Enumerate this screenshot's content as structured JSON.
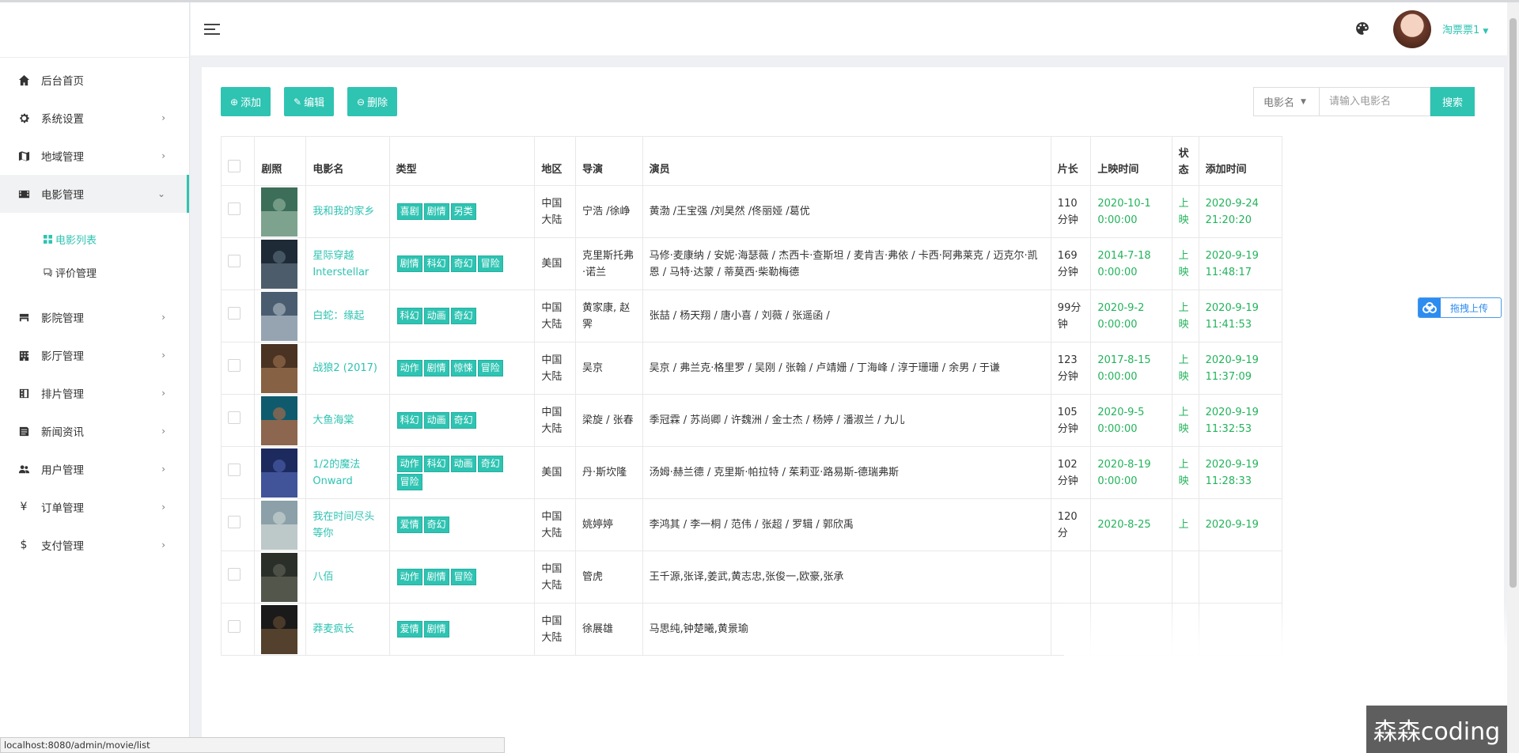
{
  "sidebar": {
    "items": [
      {
        "label": "后台首页",
        "icon": "home-icon"
      },
      {
        "label": "系统设置",
        "icon": "gear-icon"
      },
      {
        "label": "地域管理",
        "icon": "map-icon"
      },
      {
        "label": "电影管理",
        "icon": "film-icon"
      },
      {
        "label": "影院管理",
        "icon": "cinema-icon"
      },
      {
        "label": "影厅管理",
        "icon": "building-icon"
      },
      {
        "label": "排片管理",
        "icon": "schedule-icon"
      },
      {
        "label": "新闻资讯",
        "icon": "news-icon"
      },
      {
        "label": "用户管理",
        "icon": "users-icon"
      },
      {
        "label": "订单管理",
        "icon": "yen-icon"
      },
      {
        "label": "支付管理",
        "icon": "dollar-icon"
      }
    ],
    "movie_sub": [
      {
        "label": "电影列表",
        "icon": "grid-icon"
      },
      {
        "label": "评价管理",
        "icon": "comment-icon"
      }
    ]
  },
  "header": {
    "username": "淘票票1",
    "theme_icon": "palette-icon"
  },
  "toolbar": {
    "add_label": "添加",
    "edit_label": "编辑",
    "delete_label": "删除",
    "search_field": "电影名",
    "search_placeholder": "请输入电影名",
    "search_label": "搜索"
  },
  "table": {
    "headers": [
      "剧照",
      "电影名",
      "类型",
      "地区",
      "导演",
      "演员",
      "片长",
      "上映时间",
      "状态",
      "添加时间"
    ],
    "rows": [
      {
        "name": "我和我的家乡",
        "tags": [
          "喜剧",
          "剧情",
          "另类"
        ],
        "region": "中国大陆",
        "director": "宁浩 /徐峥",
        "actors": "黄渤 /王宝强 /刘昊然 /佟丽娅 /葛优",
        "duration": "110分钟",
        "release": "2020-10-1 0:00:00",
        "status": "上映",
        "added": "2020-9-24 21:20:20"
      },
      {
        "name": "星际穿越 Interstellar",
        "tags": [
          "剧情",
          "科幻",
          "奇幻",
          "冒险"
        ],
        "region": "美国",
        "director": "克里斯托弗·诺兰",
        "actors": "马修·麦康纳 / 安妮·海瑟薇 / 杰西卡·查斯坦 / 麦肯吉·弗依 / 卡西·阿弗莱克 / 迈克尔·凯恩 / 马特·达蒙 / 蒂莫西·柴勒梅德",
        "duration": "169分钟",
        "release": "2014-7-18 0:00:00",
        "status": "上映",
        "added": "2020-9-19 11:48:17"
      },
      {
        "name": "白蛇：缘起",
        "tags": [
          "科幻",
          "动画",
          "奇幻"
        ],
        "region": "中国大陆",
        "director": "黄家康, 赵霁",
        "actors": "张喆 / 杨天翔 / 唐小喜 / 刘薇 / 张遥函 /",
        "duration": "99分钟",
        "release": "2020-9-2 0:00:00",
        "status": "上映",
        "added": "2020-9-19 11:41:53"
      },
      {
        "name": "战狼2 (2017)",
        "tags": [
          "动作",
          "剧情",
          "惊悚",
          "冒险"
        ],
        "region": "中国大陆",
        "director": "吴京",
        "actors": "吴京 / 弗兰克·格里罗 / 吴刚 / 张翰 / 卢靖姗 / 丁海峰 / 淳于珊珊 / 余男 / 于谦",
        "duration": "123分钟",
        "release": "2017-8-15 0:00:00",
        "status": "上映",
        "added": "2020-9-19 11:37:09"
      },
      {
        "name": "大鱼海棠",
        "tags": [
          "科幻",
          "动画",
          "奇幻"
        ],
        "region": "中国大陆",
        "director": "梁旋 / 张春",
        "actors": "季冠霖 / 苏尚卿 / 许魏洲 / 金士杰 / 杨婷 / 潘淑兰 / 九儿",
        "duration": "105分钟",
        "release": "2020-9-5 0:00:00",
        "status": "上映",
        "added": "2020-9-19 11:32:53"
      },
      {
        "name": "1/2的魔法 Onward",
        "tags": [
          "动作",
          "科幻",
          "动画",
          "奇幻",
          "冒险"
        ],
        "region": "美国",
        "director": "丹·斯坎隆",
        "actors": "汤姆·赫兰德 / 克里斯·帕拉特 / 茱莉亚·路易斯-德瑞弗斯",
        "duration": "102分钟",
        "release": "2020-8-19 0:00:00",
        "status": "上映",
        "added": "2020-9-19 11:28:33"
      },
      {
        "name": "我在时间尽头等你",
        "tags": [
          "爱情",
          "奇幻"
        ],
        "region": "中国大陆",
        "director": "姚婷婷",
        "actors": "李鸿其 / 李一桐 / 范伟 / 张超 / 罗辑 / 郭欣禹",
        "duration": "120分",
        "release": "2020-8-25",
        "status": "上",
        "added": "2020-9-19"
      },
      {
        "name": "八佰",
        "tags": [
          "动作",
          "剧情",
          "冒险"
        ],
        "region": "中国大陆",
        "director": "管虎",
        "actors": "王千源,张译,姜武,黄志忠,张俊一,欧豪,张承",
        "duration": "",
        "release": "",
        "status": "",
        "added": ""
      },
      {
        "name": "莽麦疯长",
        "tags": [
          "爱情",
          "剧情"
        ],
        "region": "中国大陆",
        "director": "徐展雄",
        "actors": "马思纯,钟楚曦,黄景瑜",
        "duration": "",
        "release": "",
        "status": "",
        "added": ""
      }
    ]
  },
  "overlay": {
    "upload_label": "拖拽上传",
    "status_url": "localhost:8080/admin/movie/list",
    "watermark": "森森coding"
  },
  "colors": {
    "accent": "#2fc3b2",
    "date_green": "#22b35a"
  }
}
